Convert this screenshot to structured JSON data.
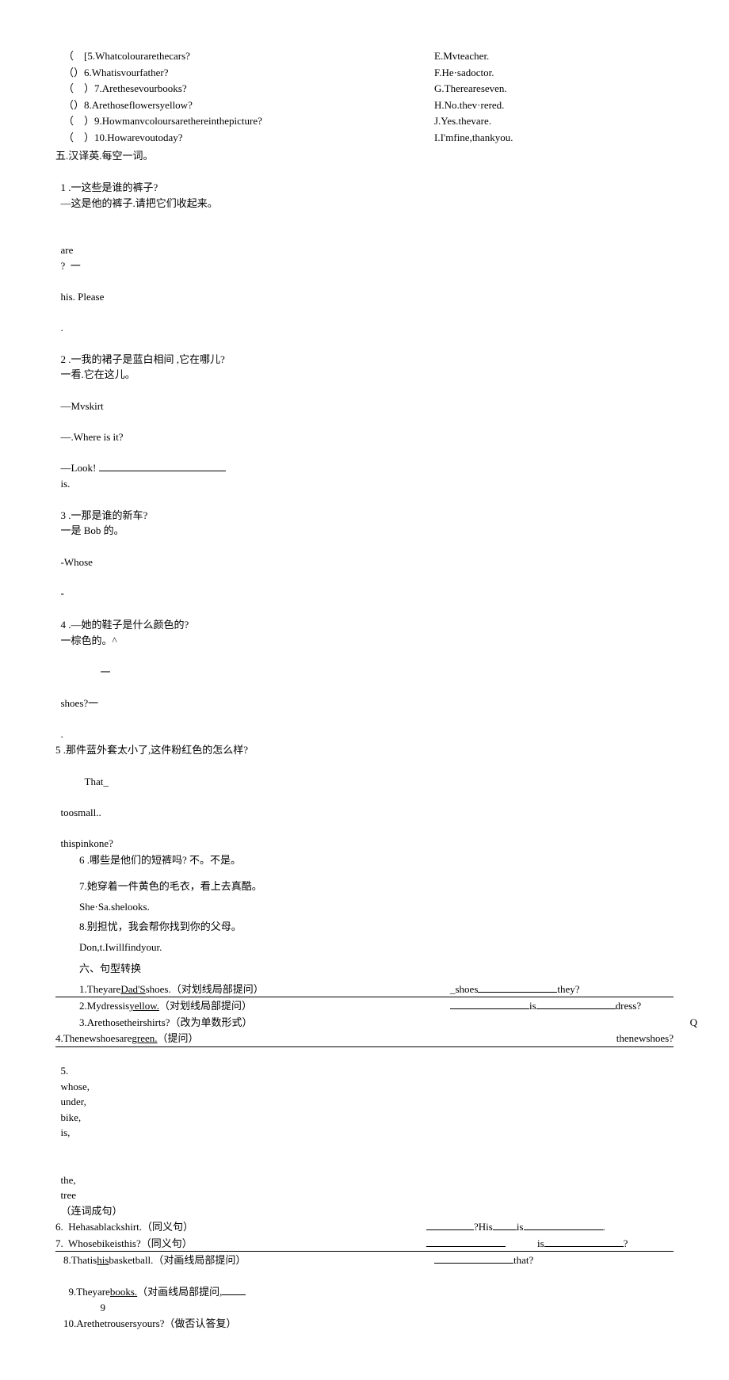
{
  "match": {
    "items": [
      {
        "n": "5",
        "q": "Whatcolourarethecars?",
        "a": "E.Mvteacher."
      },
      {
        "n": "6",
        "q": "Whatisvourfather?",
        "a": "F.He·sadoctor."
      },
      {
        "n": "7",
        "q": "Arethesevourbooks?",
        "a": "G.Thereareseven."
      },
      {
        "n": "8",
        "q": "Arethoseflowersyellow?",
        "a": "H.No.thev·rered."
      },
      {
        "n": "9",
        "q": "Howmanvcoloursarethereinthepicture?",
        "a": "J.Yes.thevare."
      },
      {
        "n": "10",
        "q": "Howarevoutoday?",
        "a": "I.I'mfine,thankyou."
      }
    ]
  },
  "sec5": {
    "title": "五.汉译英.每空一词。",
    "q1a": "1 .一这些是谁的裤子?",
    "q1b": "—这是他的裤子.请把它们收起来。",
    "q1c_are": "are",
    "q1c_qm": "?  一",
    "q1c_his": "his. Please",
    "q1c_dot": ".",
    "q2a": "2 .一我的裙子是蓝白相间 ,它在哪儿?",
    "q2b": "一看.它在这儿。",
    "q2c": "—Mvskirt",
    "q2d": "—.Where is it?",
    "q2e": "—Look! ",
    "q2f": "is.",
    "q3a": "3 .一那是谁的新车?",
    "q3b": "一是 Bob 的。",
    "q3c": "-Whose",
    "q3d": "-",
    "q4a": "4 .—她的鞋子是什么颜色的?",
    "q4b": "一棕色的。^",
    "q4c": "一",
    "q4d": "shoes?一",
    "q4e": ".",
    "q5a": "5 .那件蓝外套太小了,这件粉红色的怎么样?",
    "q5b": "That_",
    "q5c": "toosmall..",
    "q5d": "thispinkone?",
    "q6a": "6 .哪些是他们的短裤吗? 不。不是。",
    "q7a": "7.她穿着一件黄色的毛衣，看上去真酷。",
    "q7b": "She·Sa.shelooks.",
    "q8a": "8.别担忧，我会帮你找到你的父母。",
    "q8b": "Don,t.Iwillfindyour."
  },
  "sec6": {
    "title": "六、句型转换",
    "q1a": "1.Theyare",
    "q1u": "Dad'S",
    "q1b": "shoes.（对划线局部提问）",
    "q1c": "_shoes",
    "q1d": "they?",
    "q2a": "2.Mydressis",
    "q2u": "yellow.",
    "q2b": "（对划线局部提问）",
    "q2c": "is",
    "q2d": "dress?",
    "q3a": "3.Arethosetheirshirts?（改为单数形式）",
    "q3b": "Q",
    "q4a": "4.Thenewshoesare",
    "q4u": "green.",
    "q4b": "（提问）",
    "q4c": "thenewshoes?",
    "q5a": "5.",
    "q5w1": "whose,",
    "q5w2": "under,",
    "q5w3": "bike,",
    "q5w4": "is,",
    "q5w5": "the,",
    "q5w6": "tree",
    "q5w7": "（连词成句）",
    "q6a": "6.  Hehasablackshirt.（同义句）",
    "q6b": "?His",
    "q6c": "is",
    "q6d": ".",
    "q7a": "7.  Whosebikeisthis?（同义句）",
    "q7b": "is",
    "q7c": "?",
    "q8a": "8.Thatis",
    "q8u": "his",
    "q8b": "basketball.（对画线局部提问）",
    "q8c": "that?",
    "q9a": "9.Theyare",
    "q9u": "books.",
    "q9b": "（对画线局部提问,",
    "q9c": "9",
    "q10a": "10.Arethetrousersyours?（做否认答复）"
  }
}
